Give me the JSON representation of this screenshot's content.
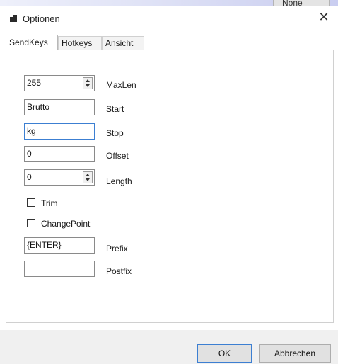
{
  "background": {
    "list_value": "None"
  },
  "window": {
    "title": "Optionen",
    "close_glyph": "✕"
  },
  "tabs": [
    {
      "label": "SendKeys",
      "active": true
    },
    {
      "label": "Hotkeys",
      "active": false
    },
    {
      "label": "Ansicht",
      "active": false
    }
  ],
  "sendkeys": {
    "maxlen": {
      "value": "255",
      "label": "MaxLen"
    },
    "start": {
      "value": "Brutto",
      "label": "Start"
    },
    "stop": {
      "value": "kg",
      "label": "Stop"
    },
    "offset": {
      "value": "0",
      "label": "Offset"
    },
    "length": {
      "value": "0",
      "label": "Length"
    },
    "trim": {
      "label": "Trim",
      "checked": false
    },
    "changepoint": {
      "label": "ChangePoint",
      "checked": false
    },
    "prefix": {
      "value": "{ENTER}",
      "label": "Prefix"
    },
    "postfix": {
      "value": "",
      "label": "Postfix"
    }
  },
  "buttons": {
    "ok": "OK",
    "cancel": "Abbrechen"
  },
  "colors": {
    "focus_border": "#3c7fd2",
    "footer_bg": "#f0f0f0"
  },
  "icons": {
    "app": "window-app-icon",
    "close": "close-icon",
    "spin": "spinner-arrows-icon"
  }
}
